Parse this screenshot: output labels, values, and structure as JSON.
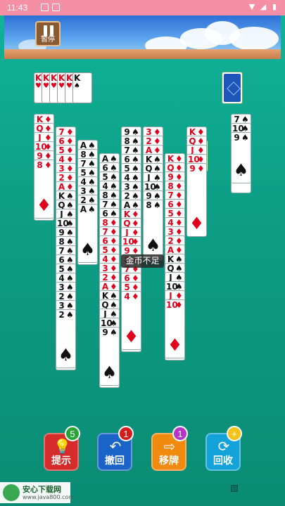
{
  "status_bar": {
    "time": "11:43"
  },
  "header": {
    "pause_label": "暂停"
  },
  "foundation": [
    "K",
    "K",
    "K",
    "K",
    "K",
    "K"
  ],
  "toast": "金币不足",
  "buttons": [
    {
      "label": "提示",
      "badge": "5",
      "color": "#d52b2b",
      "badge_color": "#27a534",
      "icon": "bulb-icon"
    },
    {
      "label": "撤回",
      "badge": "1",
      "color": "#1a63c7",
      "badge_color": "#d31d1d",
      "icon": "undo-icon"
    },
    {
      "label": "移牌",
      "badge": "1",
      "color": "#f28a10",
      "badge_color": "#b534c9",
      "icon": "move-icon"
    },
    {
      "label": "回收",
      "badge": "+",
      "color": "#13a3d9",
      "badge_color": "#f2c318",
      "icon": "recycle-icon"
    }
  ],
  "watermark": {
    "title": "安心下载网",
    "url": "www.java800.com"
  },
  "columns": [
    {
      "cards": [
        {
          "r": "K",
          "s": "♦"
        },
        {
          "r": "Q",
          "s": "♦"
        },
        {
          "r": "J",
          "s": "♦"
        },
        {
          "r": "10",
          "s": "♦"
        },
        {
          "r": "9",
          "s": "♦"
        },
        {
          "r": "8",
          "s": "♦"
        }
      ]
    },
    {
      "cards": [
        {
          "r": "7",
          "s": "♦"
        },
        {
          "r": "6",
          "s": "♦"
        },
        {
          "r": "5",
          "s": "♦"
        },
        {
          "r": "4",
          "s": "♦"
        },
        {
          "r": "3",
          "s": "♦"
        },
        {
          "r": "2",
          "s": "♦"
        },
        {
          "r": "A",
          "s": "♦"
        },
        {
          "r": "K",
          "s": "♠"
        },
        {
          "r": "Q",
          "s": "♠"
        },
        {
          "r": "J",
          "s": "♠"
        },
        {
          "r": "10",
          "s": "♠"
        },
        {
          "r": "9",
          "s": "♠"
        },
        {
          "r": "8",
          "s": "♠"
        },
        {
          "r": "7",
          "s": "♠"
        },
        {
          "r": "6",
          "s": "♠"
        },
        {
          "r": "5",
          "s": "♠"
        },
        {
          "r": "4",
          "s": "♠"
        },
        {
          "r": "3",
          "s": "♠"
        },
        {
          "r": "2",
          "s": "♠"
        },
        {
          "r": "3",
          "s": "♠"
        },
        {
          "r": "2",
          "s": "♠"
        }
      ]
    },
    {
      "cards": [
        {
          "r": "A",
          "s": "♠"
        },
        {
          "r": "8",
          "s": "♠"
        },
        {
          "r": "7",
          "s": "♠"
        },
        {
          "r": "5",
          "s": "♠"
        },
        {
          "r": "4",
          "s": "♠"
        },
        {
          "r": "3",
          "s": "♠"
        },
        {
          "r": "2",
          "s": "♠"
        },
        {
          "r": "A",
          "s": "♠"
        }
      ]
    },
    {
      "cards": [
        {
          "r": "A",
          "s": "♠"
        },
        {
          "r": "6",
          "s": "♠"
        },
        {
          "r": "5",
          "s": "♠"
        },
        {
          "r": "4",
          "s": "♠"
        },
        {
          "r": "8",
          "s": "♠"
        },
        {
          "r": "7",
          "s": "♠"
        },
        {
          "r": "6",
          "s": "♠"
        },
        {
          "r": "8",
          "s": "♦"
        },
        {
          "r": "7",
          "s": "♦"
        },
        {
          "r": "6",
          "s": "♦"
        },
        {
          "r": "5",
          "s": "♦"
        },
        {
          "r": "4",
          "s": "♦"
        },
        {
          "r": "3",
          "s": "♦"
        },
        {
          "r": "2",
          "s": "♦"
        },
        {
          "r": "A",
          "s": "♦"
        },
        {
          "r": "K",
          "s": "♠"
        },
        {
          "r": "Q",
          "s": "♠"
        },
        {
          "r": "J",
          "s": "♠"
        },
        {
          "r": "10",
          "s": "♠"
        },
        {
          "r": "9",
          "s": "♠"
        }
      ]
    },
    {
      "cards": [
        {
          "r": "9",
          "s": "♠"
        },
        {
          "r": "8",
          "s": "♠"
        },
        {
          "r": "7",
          "s": "♠"
        },
        {
          "r": "6",
          "s": "♠"
        },
        {
          "r": "5",
          "s": "♠"
        },
        {
          "r": "4",
          "s": "♠"
        },
        {
          "r": "3",
          "s": "♠"
        },
        {
          "r": "2",
          "s": "♠"
        },
        {
          "r": "A",
          "s": "♠"
        },
        {
          "r": "K",
          "s": "♦"
        },
        {
          "r": "Q",
          "s": "♦"
        },
        {
          "r": "J",
          "s": "♦"
        },
        {
          "r": "10",
          "s": "♦"
        },
        {
          "r": "9",
          "s": "♦"
        },
        {
          "r": "8",
          "s": "♦"
        },
        {
          "r": "7",
          "s": "♦"
        },
        {
          "r": "6",
          "s": "♦"
        },
        {
          "r": "5",
          "s": "♦"
        },
        {
          "r": "4",
          "s": "♦"
        }
      ]
    },
    {
      "cards": [
        {
          "r": "3",
          "s": "♦"
        },
        {
          "r": "2",
          "s": "♦"
        },
        {
          "r": "A",
          "s": "♦"
        },
        {
          "r": "K",
          "s": "♠"
        },
        {
          "r": "Q",
          "s": "♠"
        },
        {
          "r": "J",
          "s": "♠"
        },
        {
          "r": "10",
          "s": "♠"
        },
        {
          "r": "9",
          "s": "♠"
        },
        {
          "r": "8",
          "s": "♠"
        }
      ]
    },
    {
      "cards": [
        {
          "r": "K",
          "s": "♦"
        },
        {
          "r": "Q",
          "s": "♦"
        },
        {
          "r": "9",
          "s": "♦"
        },
        {
          "r": "8",
          "s": "♦"
        },
        {
          "r": "7",
          "s": "♦"
        },
        {
          "r": "6",
          "s": "♦"
        },
        {
          "r": "5",
          "s": "♦"
        },
        {
          "r": "4",
          "s": "♦"
        },
        {
          "r": "3",
          "s": "♦"
        },
        {
          "r": "2",
          "s": "♦"
        },
        {
          "r": "A",
          "s": "♦"
        },
        {
          "r": "K",
          "s": "♠"
        },
        {
          "r": "Q",
          "s": "♠"
        },
        {
          "r": "J",
          "s": "♠"
        },
        {
          "r": "10",
          "s": "♠"
        },
        {
          "r": "J",
          "s": "♦"
        },
        {
          "r": "10",
          "s": "♦"
        }
      ]
    },
    {
      "cards": [
        {
          "r": "K",
          "s": "♦"
        },
        {
          "r": "Q",
          "s": "♦"
        },
        {
          "r": "J",
          "s": "♦"
        },
        {
          "r": "10",
          "s": "♦"
        },
        {
          "r": "9",
          "s": "♦"
        }
      ]
    },
    {
      "cards": [
        {
          "r": "7",
          "s": "♠"
        },
        {
          "r": "10",
          "s": "♠"
        },
        {
          "r": "9",
          "s": "♠"
        }
      ]
    }
  ]
}
